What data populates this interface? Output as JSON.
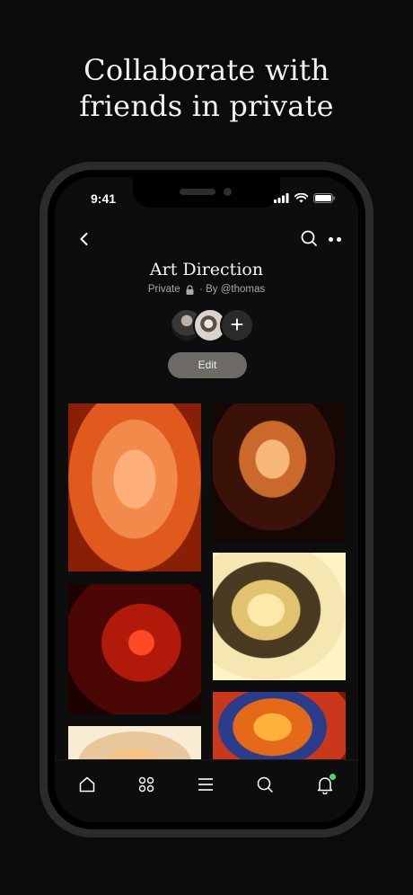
{
  "promo": {
    "headline_line1": "Collaborate with",
    "headline_line2": "friends in private"
  },
  "status_bar": {
    "time": "9:41",
    "icons": [
      "cellular-signal-icon",
      "wifi-icon",
      "battery-icon"
    ]
  },
  "nav": {
    "back_icon": "chevron-left-icon",
    "search_icon": "search-icon",
    "more_icon": "more-dots-icon"
  },
  "board": {
    "title": "Art Direction",
    "privacy": "Private",
    "separator": "·",
    "author": "By @thomas",
    "edit_label": "Edit",
    "add_collaborator_glyph": "+"
  },
  "pins": [
    {
      "name": "pin-1"
    },
    {
      "name": "pin-2"
    },
    {
      "name": "pin-3"
    },
    {
      "name": "pin-4"
    },
    {
      "name": "pin-5"
    },
    {
      "name": "pin-6"
    }
  ],
  "tabbar": {
    "items": [
      "home-icon",
      "boards-grid-icon",
      "menu-lines-icon",
      "search-icon",
      "bell-icon"
    ],
    "notification_dot_color": "#3ddc73"
  },
  "colors": {
    "background": "#0b0b0b",
    "phone_frame": "#2b2b2b",
    "edit_button": "#6e6a66"
  }
}
